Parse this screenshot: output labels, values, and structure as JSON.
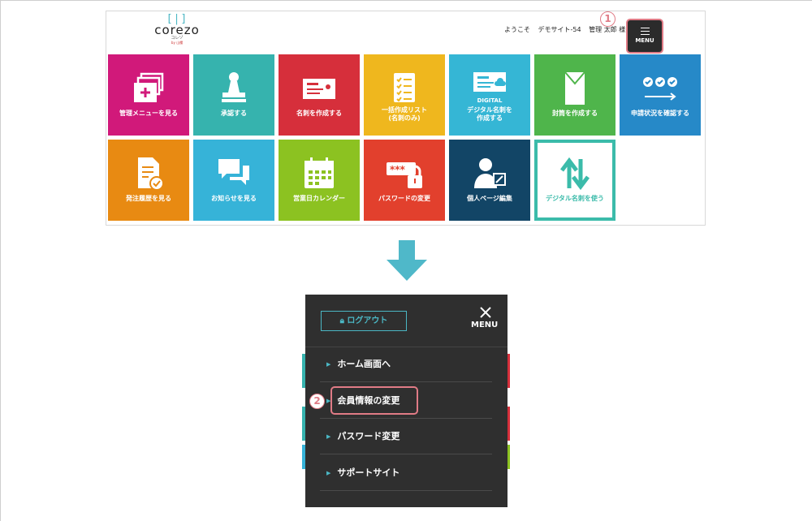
{
  "header": {
    "logo_mark": "[|]",
    "logo_text": "corezo",
    "logo_sub": "コレゾ",
    "logo_sub2": "by 山櫻",
    "welcome": [
      "ようこそ",
      "デモサイト-54",
      "管理 太郎 様"
    ],
    "menu_label": "MENU"
  },
  "steps": {
    "one": "1",
    "two": "2"
  },
  "tiles": [
    {
      "label": "管理メニューを見る",
      "color": "#d1197a",
      "icon": "folders-icon"
    },
    {
      "label": "承認する",
      "color": "#36b3ae",
      "icon": "stamp-icon"
    },
    {
      "label": "名刺を作成する",
      "color": "#d62f3b",
      "icon": "business-card-icon"
    },
    {
      "label": "一括作成リスト\n(名刺のみ)",
      "color": "#efb71e",
      "icon": "checklist-icon"
    },
    {
      "label": "デジタル名刺を\n作成する",
      "color": "#35b6d5",
      "icon": "digital-card-icon",
      "top": "DIGITAL"
    },
    {
      "label": "封筒を作成する",
      "color": "#4fb54b",
      "icon": "envelope-icon"
    },
    {
      "label": "申請状況を確認する",
      "color": "#2689c8",
      "icon": "progress-icon"
    },
    {
      "label": "発注履歴を見る",
      "color": "#e88a12",
      "icon": "document-check-icon"
    },
    {
      "label": "お知らせを見る",
      "color": "#36b3d8",
      "icon": "chat-icon"
    },
    {
      "label": "営業日カレンダー",
      "color": "#8cc221",
      "icon": "calendar-icon"
    },
    {
      "label": "パスワードの変更",
      "color": "#e2402d",
      "icon": "password-lock-icon"
    },
    {
      "label": "個人ページ編集",
      "color": "#124566",
      "icon": "user-edit-icon"
    },
    {
      "label": "デジタル名刺を使う",
      "color": "#3bbbaa",
      "icon": "swap-arrows-icon"
    }
  ],
  "menu": {
    "logout_label": "ログアウト",
    "close_label": "MENU",
    "items": [
      "ホーム画面へ",
      "会員情報の変更",
      "パスワード変更",
      "サポートサイト"
    ]
  },
  "colors": {
    "accent": "#4bb7c4",
    "highlight": "#e07b86",
    "panel": "#2f2f2f",
    "arrow": "#4fb8c9"
  }
}
